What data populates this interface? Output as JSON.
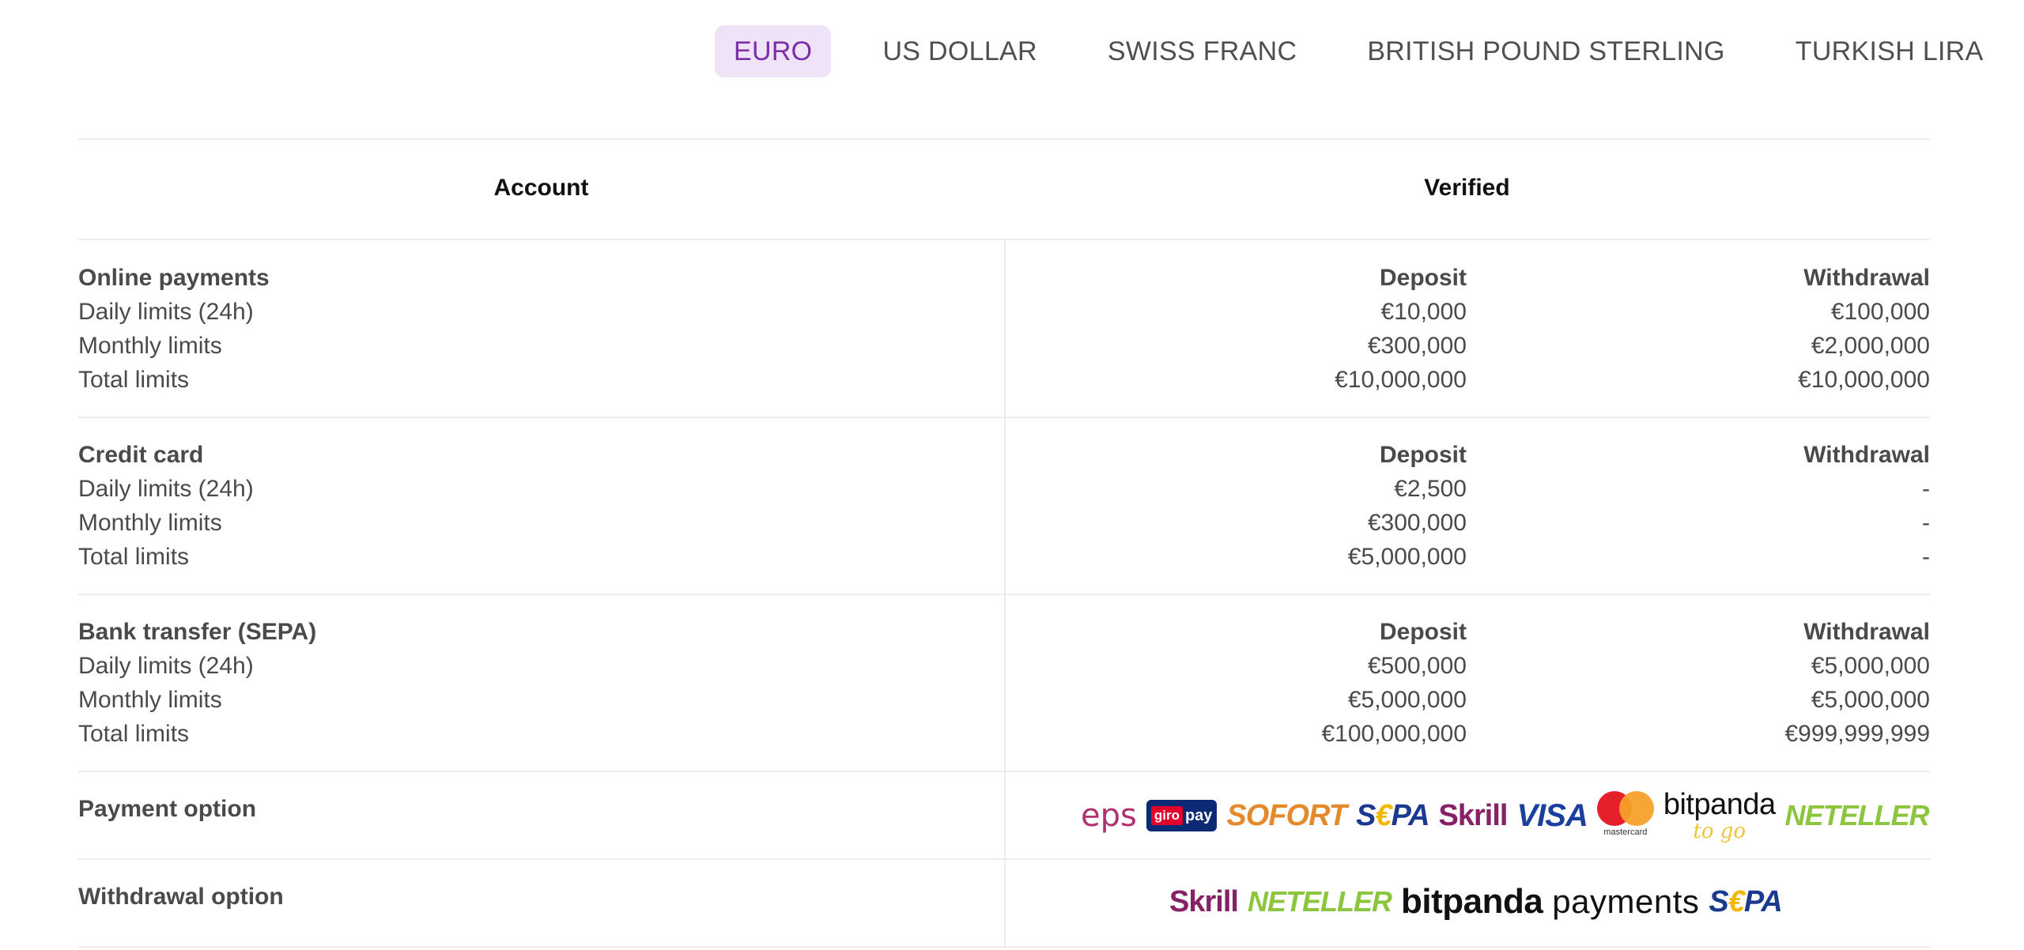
{
  "tabs": [
    {
      "label": "EURO",
      "active": true
    },
    {
      "label": "US DOLLAR",
      "active": false
    },
    {
      "label": "SWISS FRANC",
      "active": false
    },
    {
      "label": "BRITISH POUND STERLING",
      "active": false
    },
    {
      "label": "TURKISH LIRA",
      "active": false
    }
  ],
  "colors": {
    "accent": "#7b2ea8",
    "active_tab_bg": "#efe4f7"
  },
  "table": {
    "headers": {
      "account": "Account",
      "verified": "Verified"
    },
    "sections": [
      {
        "title": "Online payments",
        "deposit_label": "Deposit",
        "withdrawal_label": "Withdrawal",
        "rows": [
          {
            "label": "Daily limits (24h)",
            "deposit": "€10,000",
            "withdrawal": "€100,000"
          },
          {
            "label": "Monthly limits",
            "deposit": "€300,000",
            "withdrawal": "€2,000,000"
          },
          {
            "label": "Total limits",
            "deposit": "€10,000,000",
            "withdrawal": "€10,000,000"
          }
        ]
      },
      {
        "title": "Credit card",
        "deposit_label": "Deposit",
        "withdrawal_label": "Withdrawal",
        "rows": [
          {
            "label": "Daily limits (24h)",
            "deposit": "€2,500",
            "withdrawal": "-"
          },
          {
            "label": "Monthly limits",
            "deposit": "€300,000",
            "withdrawal": "-"
          },
          {
            "label": "Total limits",
            "deposit": "€5,000,000",
            "withdrawal": "-"
          }
        ]
      },
      {
        "title": "Bank transfer (SEPA)",
        "deposit_label": "Deposit",
        "withdrawal_label": "Withdrawal",
        "rows": [
          {
            "label": "Daily limits (24h)",
            "deposit": "€500,000",
            "withdrawal": "€5,000,000"
          },
          {
            "label": "Monthly limits",
            "deposit": "€5,000,000",
            "withdrawal": "€5,000,000"
          },
          {
            "label": "Total limits",
            "deposit": "€100,000,000",
            "withdrawal": "€999,999,999"
          }
        ]
      }
    ],
    "payment_option": {
      "label": "Payment option",
      "logos": {
        "eps": "eps",
        "giropay_1": "giro",
        "giropay_2": "pay",
        "sofort": "SOFORT",
        "sepa_1": "S",
        "sepa_2": "€",
        "sepa_3": "PA",
        "skrill": "Skrill",
        "visa": "VISA",
        "mastercard": "mastercard",
        "bitpanda": "bitpanda",
        "bitpanda_sub": "to go",
        "neteller": "NETELLER"
      }
    },
    "withdrawal_option": {
      "label": "Withdrawal option",
      "logos": {
        "skrill": "Skrill",
        "neteller": "NETELLER",
        "bitpanda": "bitpanda",
        "payments": "payments",
        "sepa_1": "S",
        "sepa_2": "€",
        "sepa_3": "PA"
      }
    }
  }
}
